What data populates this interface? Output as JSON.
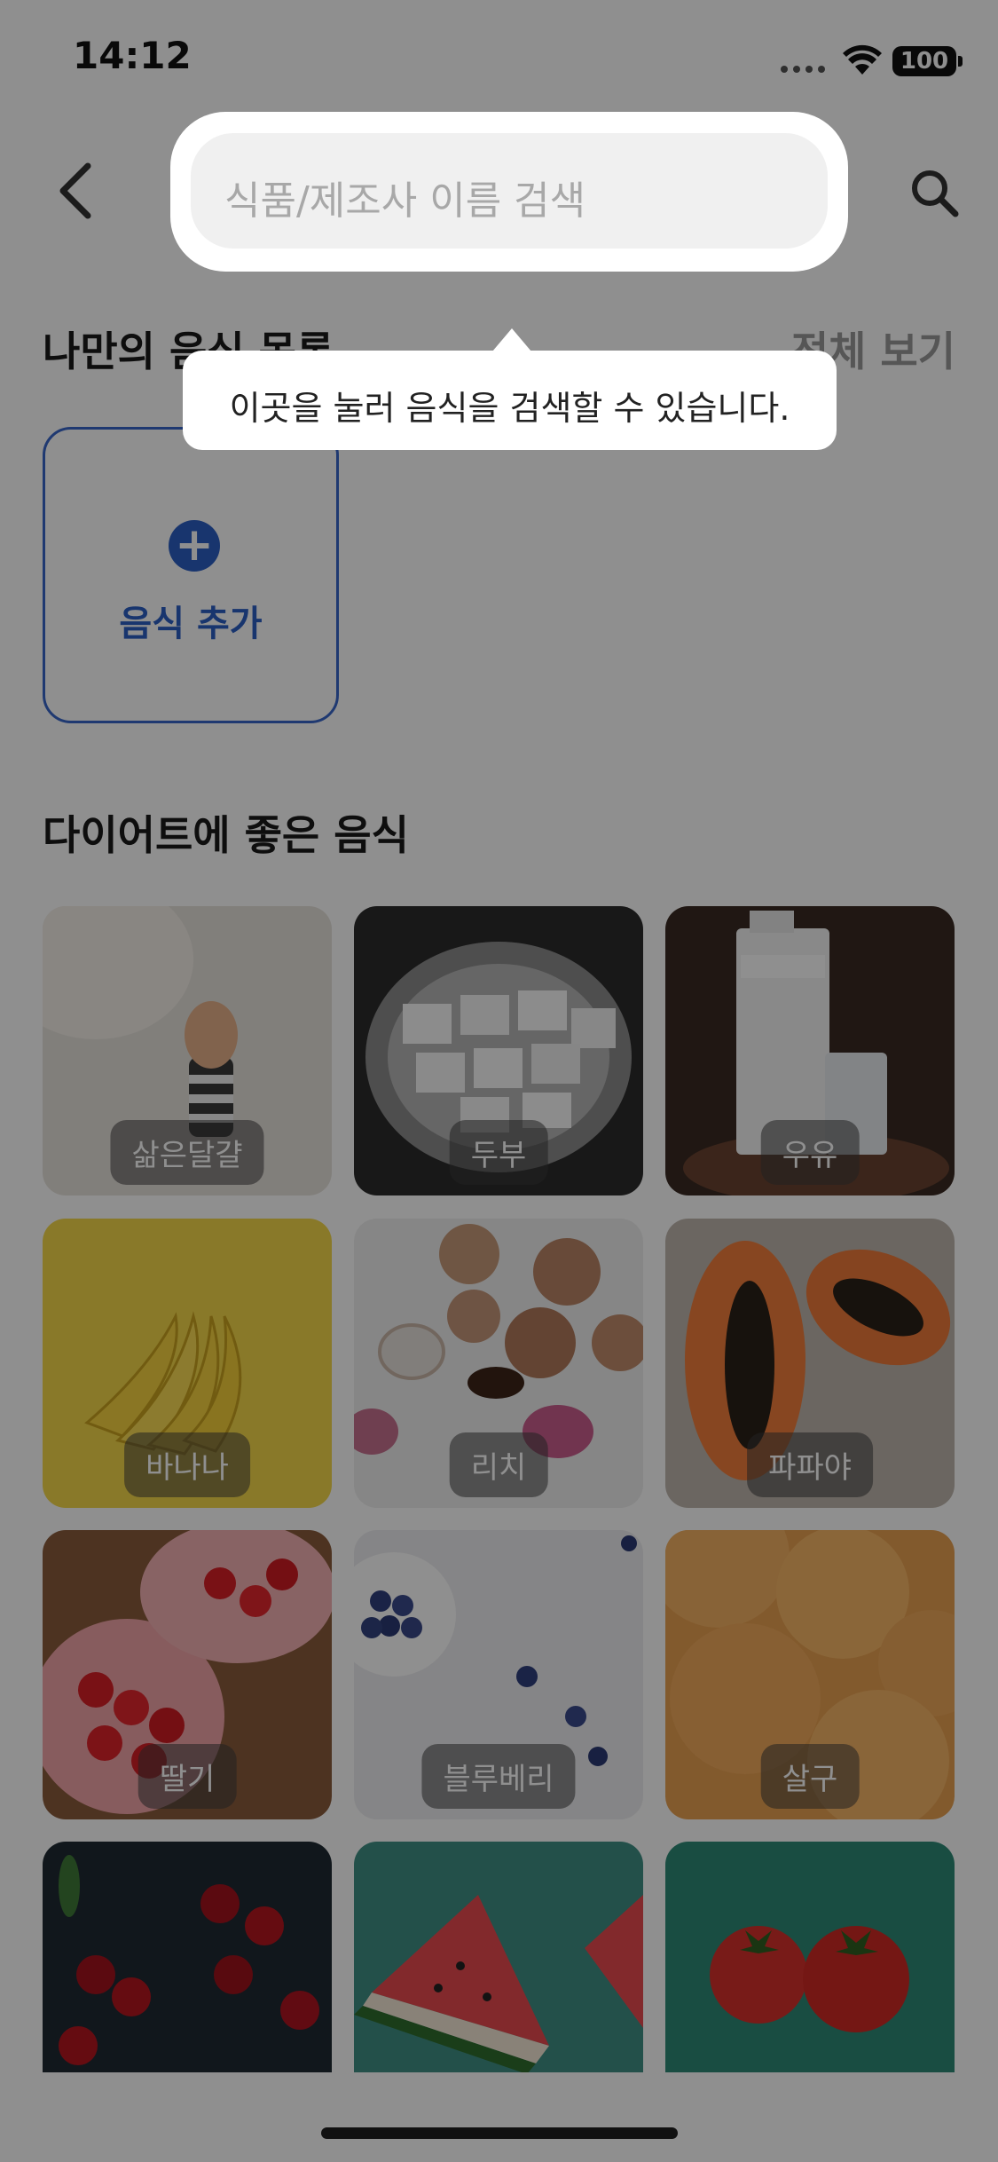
{
  "status_bar": {
    "time": "14:12",
    "battery": "100"
  },
  "header": {
    "back_icon": "chevron-left-icon",
    "search_placeholder": "식품/제조사 이름 검색",
    "search_icon": "magnifier-icon"
  },
  "my_foods": {
    "title": "나만의 음식 목록",
    "see_all": "전체 보기",
    "add_label": "음식 추가"
  },
  "diet_foods": {
    "title": "다이어트에 좋은 음식",
    "items": [
      {
        "label": "삶은달걀"
      },
      {
        "label": "두부"
      },
      {
        "label": "우유"
      },
      {
        "label": "바나나"
      },
      {
        "label": "리치"
      },
      {
        "label": "파파야"
      },
      {
        "label": "딸기"
      },
      {
        "label": "블루베리"
      },
      {
        "label": "살구"
      },
      {
        "label": ""
      },
      {
        "label": ""
      },
      {
        "label": ""
      }
    ]
  },
  "coach_mark": {
    "text": "이곳을 눌러 음식을 검색할 수 있습니다."
  },
  "colors": {
    "accent": "#2c5fc4",
    "overlay": "rgba(0,0,0,0.44)"
  }
}
